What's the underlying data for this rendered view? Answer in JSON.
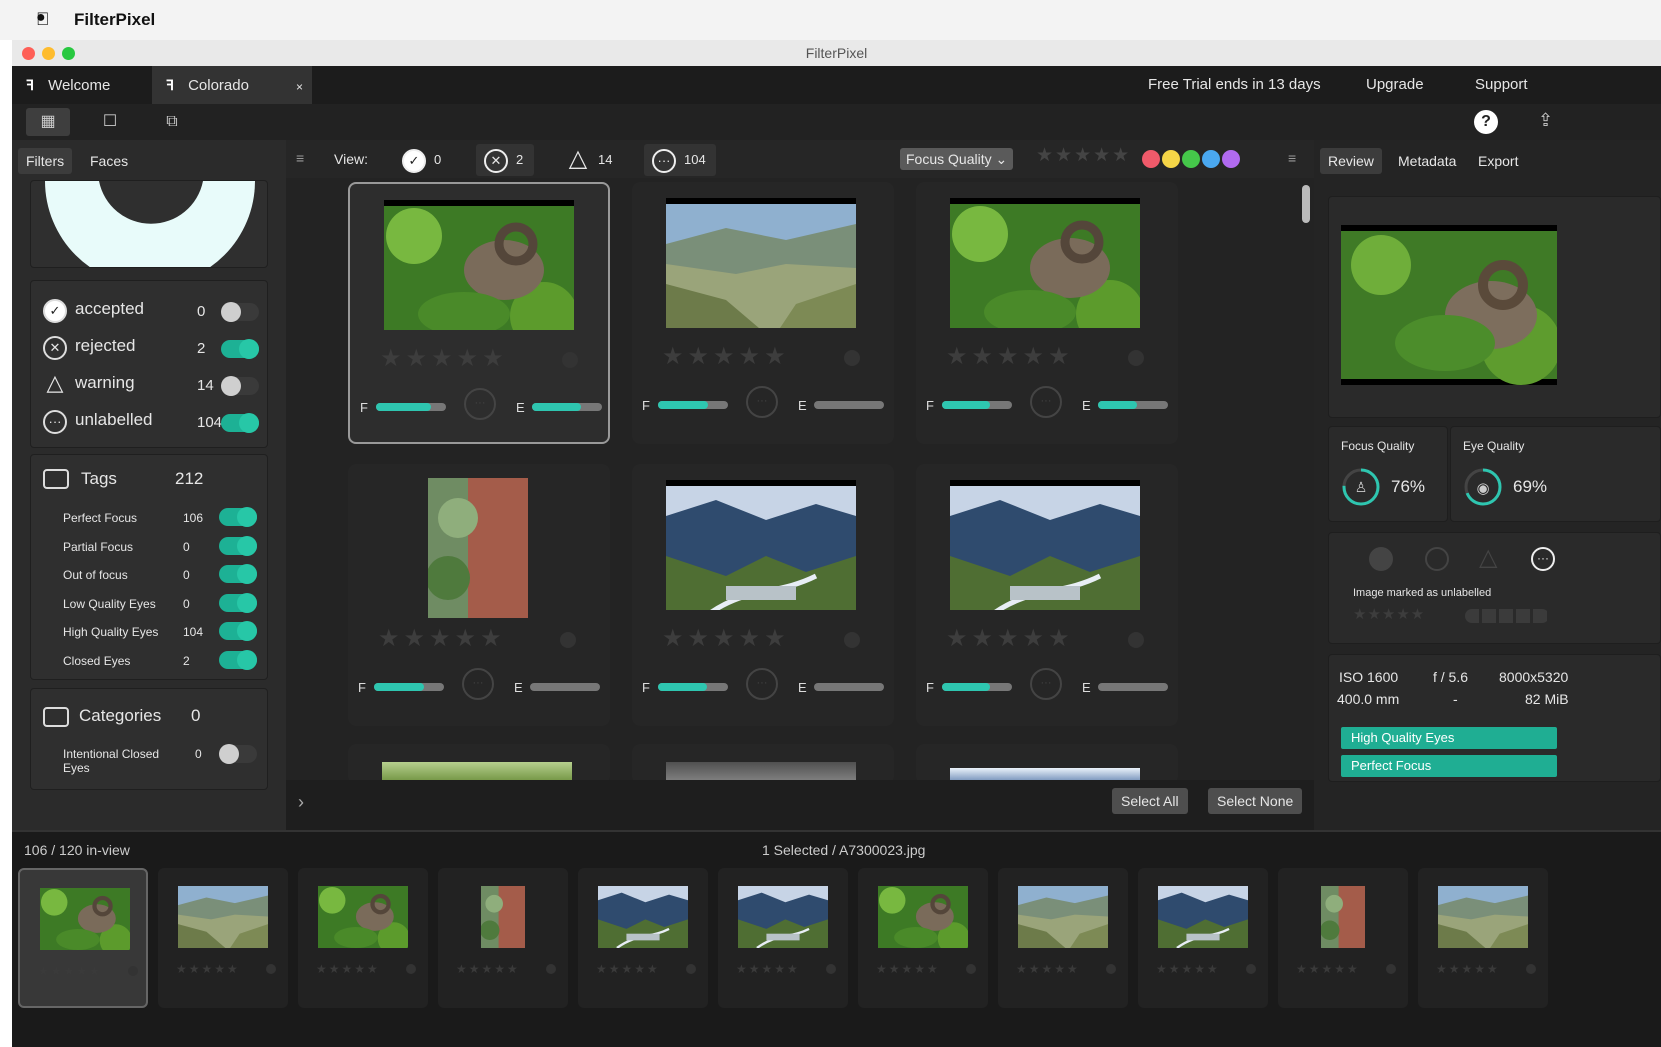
{
  "macbar": {
    "app_name": "FilterPixel"
  },
  "window": {
    "title": "FilterPixel"
  },
  "tabs": [
    {
      "icon": "filterpixel-logo-icon",
      "label": "Welcome"
    },
    {
      "icon": "filterpixel-logo-icon",
      "label": "Colorado",
      "close": "×"
    }
  ],
  "header_right": {
    "trial": "Free Trial ends in 13 days",
    "upgrade": "Upgrade",
    "support": "Support"
  },
  "left": {
    "subtabs": [
      "Filters",
      "Faces"
    ],
    "labels": [
      {
        "name": "accepted",
        "count": "0",
        "on": false,
        "icon": "check-circle-icon"
      },
      {
        "name": "rejected",
        "count": "2",
        "on": true,
        "icon": "x-circle-icon"
      },
      {
        "name": "warning",
        "count": "14",
        "on": false,
        "icon": "warning-triangle-icon"
      },
      {
        "name": "unlabelled",
        "count": "104",
        "on": true,
        "icon": "dots-circle-icon"
      }
    ],
    "tags": {
      "title": "Tags",
      "count": "212",
      "items": [
        {
          "name": "Perfect Focus",
          "count": "106"
        },
        {
          "name": "Partial Focus",
          "count": "0"
        },
        {
          "name": "Out of focus",
          "count": "0"
        },
        {
          "name": "Low Quality Eyes",
          "count": "0"
        },
        {
          "name": "High Quality Eyes",
          "count": "104"
        },
        {
          "name": "Closed Eyes",
          "count": "2"
        }
      ]
    },
    "categories": {
      "title": "Categories",
      "count": "0",
      "items": [
        {
          "name": "Intentional Closed Eyes",
          "count": "0"
        }
      ]
    }
  },
  "viewbar": {
    "label": "View:",
    "accepted": "0",
    "rejected": "2",
    "warning": "14",
    "unlabelled": "104",
    "sort": "Focus Quality",
    "stars": "★★★★★",
    "color_labels": [
      "#f05a6a",
      "#f5d547",
      "#45c74a",
      "#4aa8f0",
      "#b16af0"
    ]
  },
  "grid": {
    "stars": "★★★★★",
    "f_label": "F",
    "e_label": "E",
    "cells": [
      {
        "photo": "bighorn sheep",
        "focus": 0.78,
        "eye": 0.7
      },
      {
        "photo": "valley",
        "focus": 0.72,
        "eye": 0.0
      },
      {
        "photo": "bighorn sheep",
        "focus": 0.68,
        "eye": 0.55
      },
      {
        "photo": "tree bark",
        "focus": 0.72,
        "eye": 0.0
      },
      {
        "photo": "river valley",
        "focus": 0.7,
        "eye": 0.0
      },
      {
        "photo": "river valley",
        "focus": 0.68,
        "eye": 0.0
      }
    ],
    "select_all": "Select All",
    "select_none": "Select None"
  },
  "right": {
    "tabs": [
      "Review",
      "Metadata",
      "Export"
    ],
    "focus_title": "Focus Quality",
    "focus_value": "76%",
    "focus": 0.76,
    "eye_title": "Eye Quality",
    "eye_value": "69%",
    "eye": 0.69,
    "marked_text": "Image marked as unlabelled",
    "iso": "ISO 1600",
    "aperture": "f / 5.6",
    "dims": "8000x5320",
    "focal": "400.0 mm",
    "dash": "-",
    "size": "82 MiB",
    "tags": [
      "High Quality Eyes",
      "Perfect Focus"
    ]
  },
  "film": {
    "left": "106 / 120 in-view",
    "center": "1 Selected / A7300023.jpg",
    "stars": "★★★★★"
  }
}
